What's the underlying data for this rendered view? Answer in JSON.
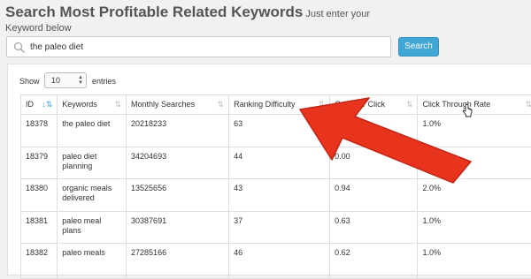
{
  "header": {
    "title": "Search Most Profitable Related Keywords",
    "title_sub": "Just enter your",
    "title_line2": "Keyword below"
  },
  "search": {
    "value": "the paleo diet",
    "button_label": "Search",
    "icon": "search-icon"
  },
  "length": {
    "show_label": "Show",
    "value": "10",
    "entries_label": "entries"
  },
  "table": {
    "columns": [
      "ID",
      "Keywords",
      "Monthly Searches",
      "Ranking Difficulty",
      "Cost Per Click",
      "Click Through Rate"
    ],
    "rows": [
      [
        "18378",
        "the paleo diet",
        "20218233",
        "63",
        "",
        "1.0%"
      ],
      [
        "18379",
        "paleo diet planning",
        "34204693",
        "44",
        "0.00",
        ""
      ],
      [
        "18380",
        "organic meals delivered",
        "13525656",
        "43",
        "0.94",
        "2.0%"
      ],
      [
        "18381",
        "paleo meal plans",
        "30387691",
        "37",
        "0.63",
        "1.0%"
      ],
      [
        "18382",
        "paleo meals",
        "27285166",
        "46",
        "0.62",
        "1.0%"
      ]
    ]
  },
  "colors": {
    "accent": "#3fa6d5",
    "annotation_arrow": "#e8341d"
  }
}
